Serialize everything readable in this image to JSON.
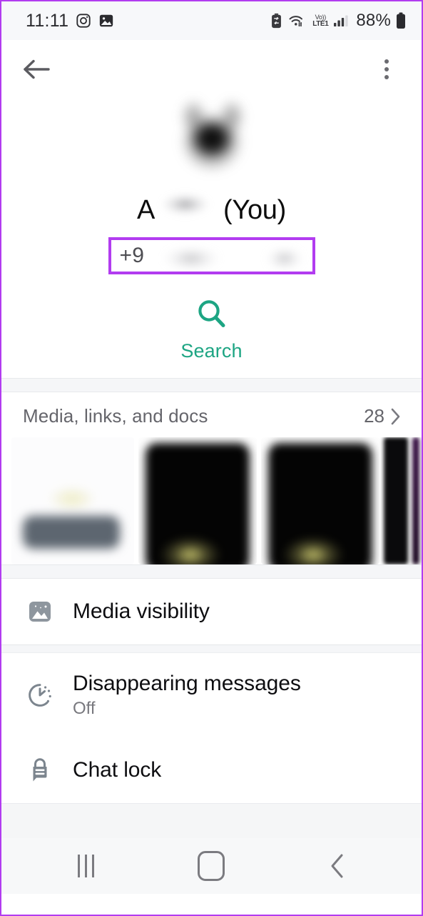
{
  "status_bar": {
    "time": "11:11",
    "battery_percent": "88%",
    "network_top": "Vo))",
    "network_bottom": "LTE1",
    "icons": [
      "instagram-icon",
      "gallery-icon",
      "battery-saver-icon",
      "wifi-icon",
      "volte-icon",
      "signal-icon",
      "battery-icon"
    ]
  },
  "appbar": {
    "back_label": "back-arrow",
    "menu_label": "overflow-menu"
  },
  "profile": {
    "avatar_label": "profile-photo",
    "name_prefix": "A",
    "name_suffix": "(You)",
    "phone_number": "+9",
    "highlight_color": "#b23cf0",
    "search_label": "Search",
    "accent_color": "#1da583"
  },
  "media": {
    "title": "Media, links, and docs",
    "count": "28",
    "chevron": "chevron-right-icon",
    "thumbnails": [
      {
        "name": "media-thumbnail-1",
        "kind": "light"
      },
      {
        "name": "media-thumbnail-2",
        "kind": "dark"
      },
      {
        "name": "media-thumbnail-3",
        "kind": "dark"
      },
      {
        "name": "media-thumbnail-4",
        "kind": "edge"
      }
    ]
  },
  "settings": {
    "rows": [
      {
        "name": "media-visibility",
        "icon": "photo-icon",
        "title": "Media visibility",
        "subtitle": ""
      },
      {
        "name": "disappearing-messages",
        "icon": "timer-icon",
        "title": "Disappearing messages",
        "subtitle": "Off"
      },
      {
        "name": "chat-lock",
        "icon": "lock-icon",
        "title": "Chat lock",
        "subtitle": ""
      }
    ]
  },
  "navbar": {
    "recents_label": "recent-apps",
    "home_label": "home",
    "back_label": "back"
  }
}
